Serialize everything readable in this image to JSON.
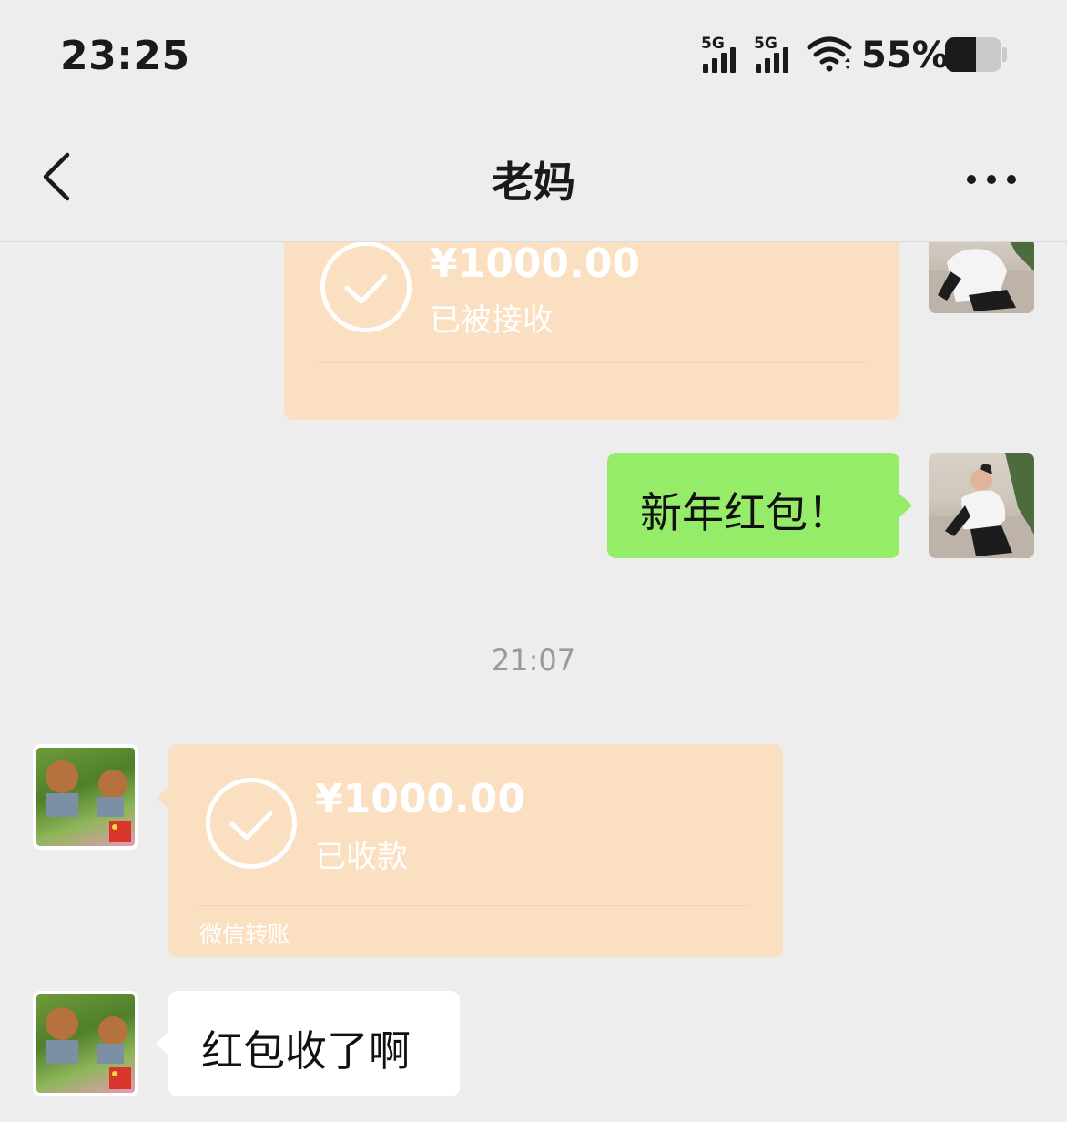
{
  "status_bar": {
    "time": "23:25",
    "signal1_label": "5G",
    "signal2_label": "5G",
    "battery_text": "55%",
    "battery_level": 0.55,
    "icons": [
      "signal-icon",
      "signal-icon",
      "wifi-icon",
      "battery-icon"
    ]
  },
  "nav": {
    "title": "老妈",
    "back_icon": "chevron-left-icon",
    "more_icon": "more-dots-icon"
  },
  "messages": [
    {
      "type": "transfer",
      "direction": "outgoing",
      "amount": "¥1000.00",
      "status": "已被接收",
      "icon": "check-circle-icon"
    },
    {
      "type": "text",
      "direction": "outgoing",
      "text": "新年红包！"
    },
    {
      "type": "timestamp",
      "text": "21:07"
    },
    {
      "type": "transfer",
      "direction": "incoming",
      "amount": "¥1000.00",
      "status": "已收款",
      "footer": "微信转账",
      "icon": "check-circle-icon"
    },
    {
      "type": "text",
      "direction": "incoming",
      "text": "红包收了啊"
    }
  ],
  "colors": {
    "background": "#ededed",
    "transfer_bubble": "#fadfc1",
    "outgoing_bubble": "#95ec69",
    "incoming_bubble": "#ffffff",
    "timestamp_text": "#9a9a9a"
  }
}
